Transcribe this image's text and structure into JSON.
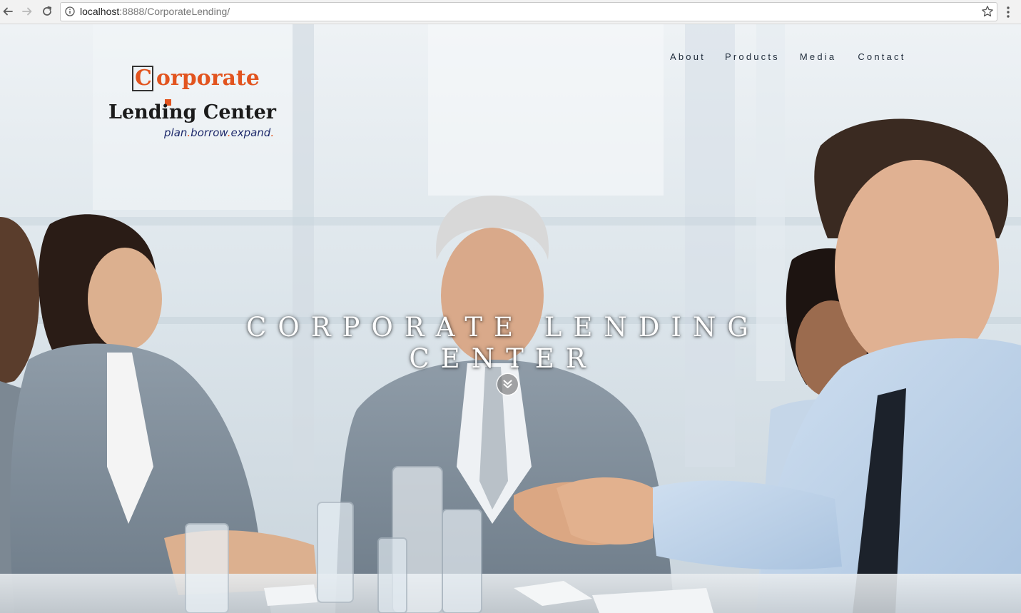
{
  "browser": {
    "url_host": "localhost",
    "url_rest": ":8888/CorporateLending/",
    "back_icon": "arrow-left-icon",
    "forward_icon": "arrow-right-icon",
    "reload_icon": "reload-icon",
    "info_icon": "info-icon",
    "bookmark_icon": "star-icon",
    "menu_icon": "more-vertical-icon"
  },
  "logo": {
    "line1_first": "C",
    "line1_rest": "orporate",
    "line2": "Lending Center",
    "tagline_1": "plan",
    "tagline_2": "borrow",
    "tagline_3": "expand",
    "tagline_dot": ".",
    "accent_color": "#e2541f",
    "tagline_color": "#1e2a6b"
  },
  "nav": {
    "about": "About",
    "products": "Products",
    "media": "Media",
    "contact": "Contact"
  },
  "hero": {
    "title_line1": "CORPORATE LENDING",
    "title_line2": "CENTER",
    "scroll_icon": "double-chevron-down-icon"
  }
}
